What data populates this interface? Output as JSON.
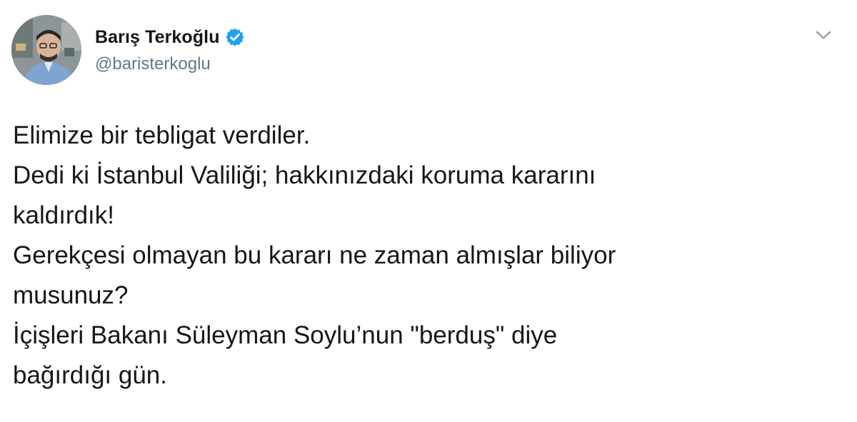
{
  "author": {
    "display_name": "Barış Terkoğlu",
    "handle": "@baristerkoglu",
    "verified": true,
    "verified_color": "#1da1f2"
  },
  "menu": {
    "icon": "chevron-down-icon"
  },
  "tweet": {
    "lines": [
      "Elimize bir tebligat verdiler.",
      "Dedi ki İstanbul Valiliği; hakkınızdaki koruma kararını",
      "kaldırdık!",
      "Gerekçesi olmayan bu kararı ne zaman almışlar biliyor",
      "musunuz?",
      "İçişleri Bakanı Süleyman Soylu’nun \"berduş\" diye",
      "bağırdığı gün."
    ]
  },
  "colors": {
    "text": "#14171a",
    "secondary": "#657786",
    "background": "#ffffff"
  }
}
